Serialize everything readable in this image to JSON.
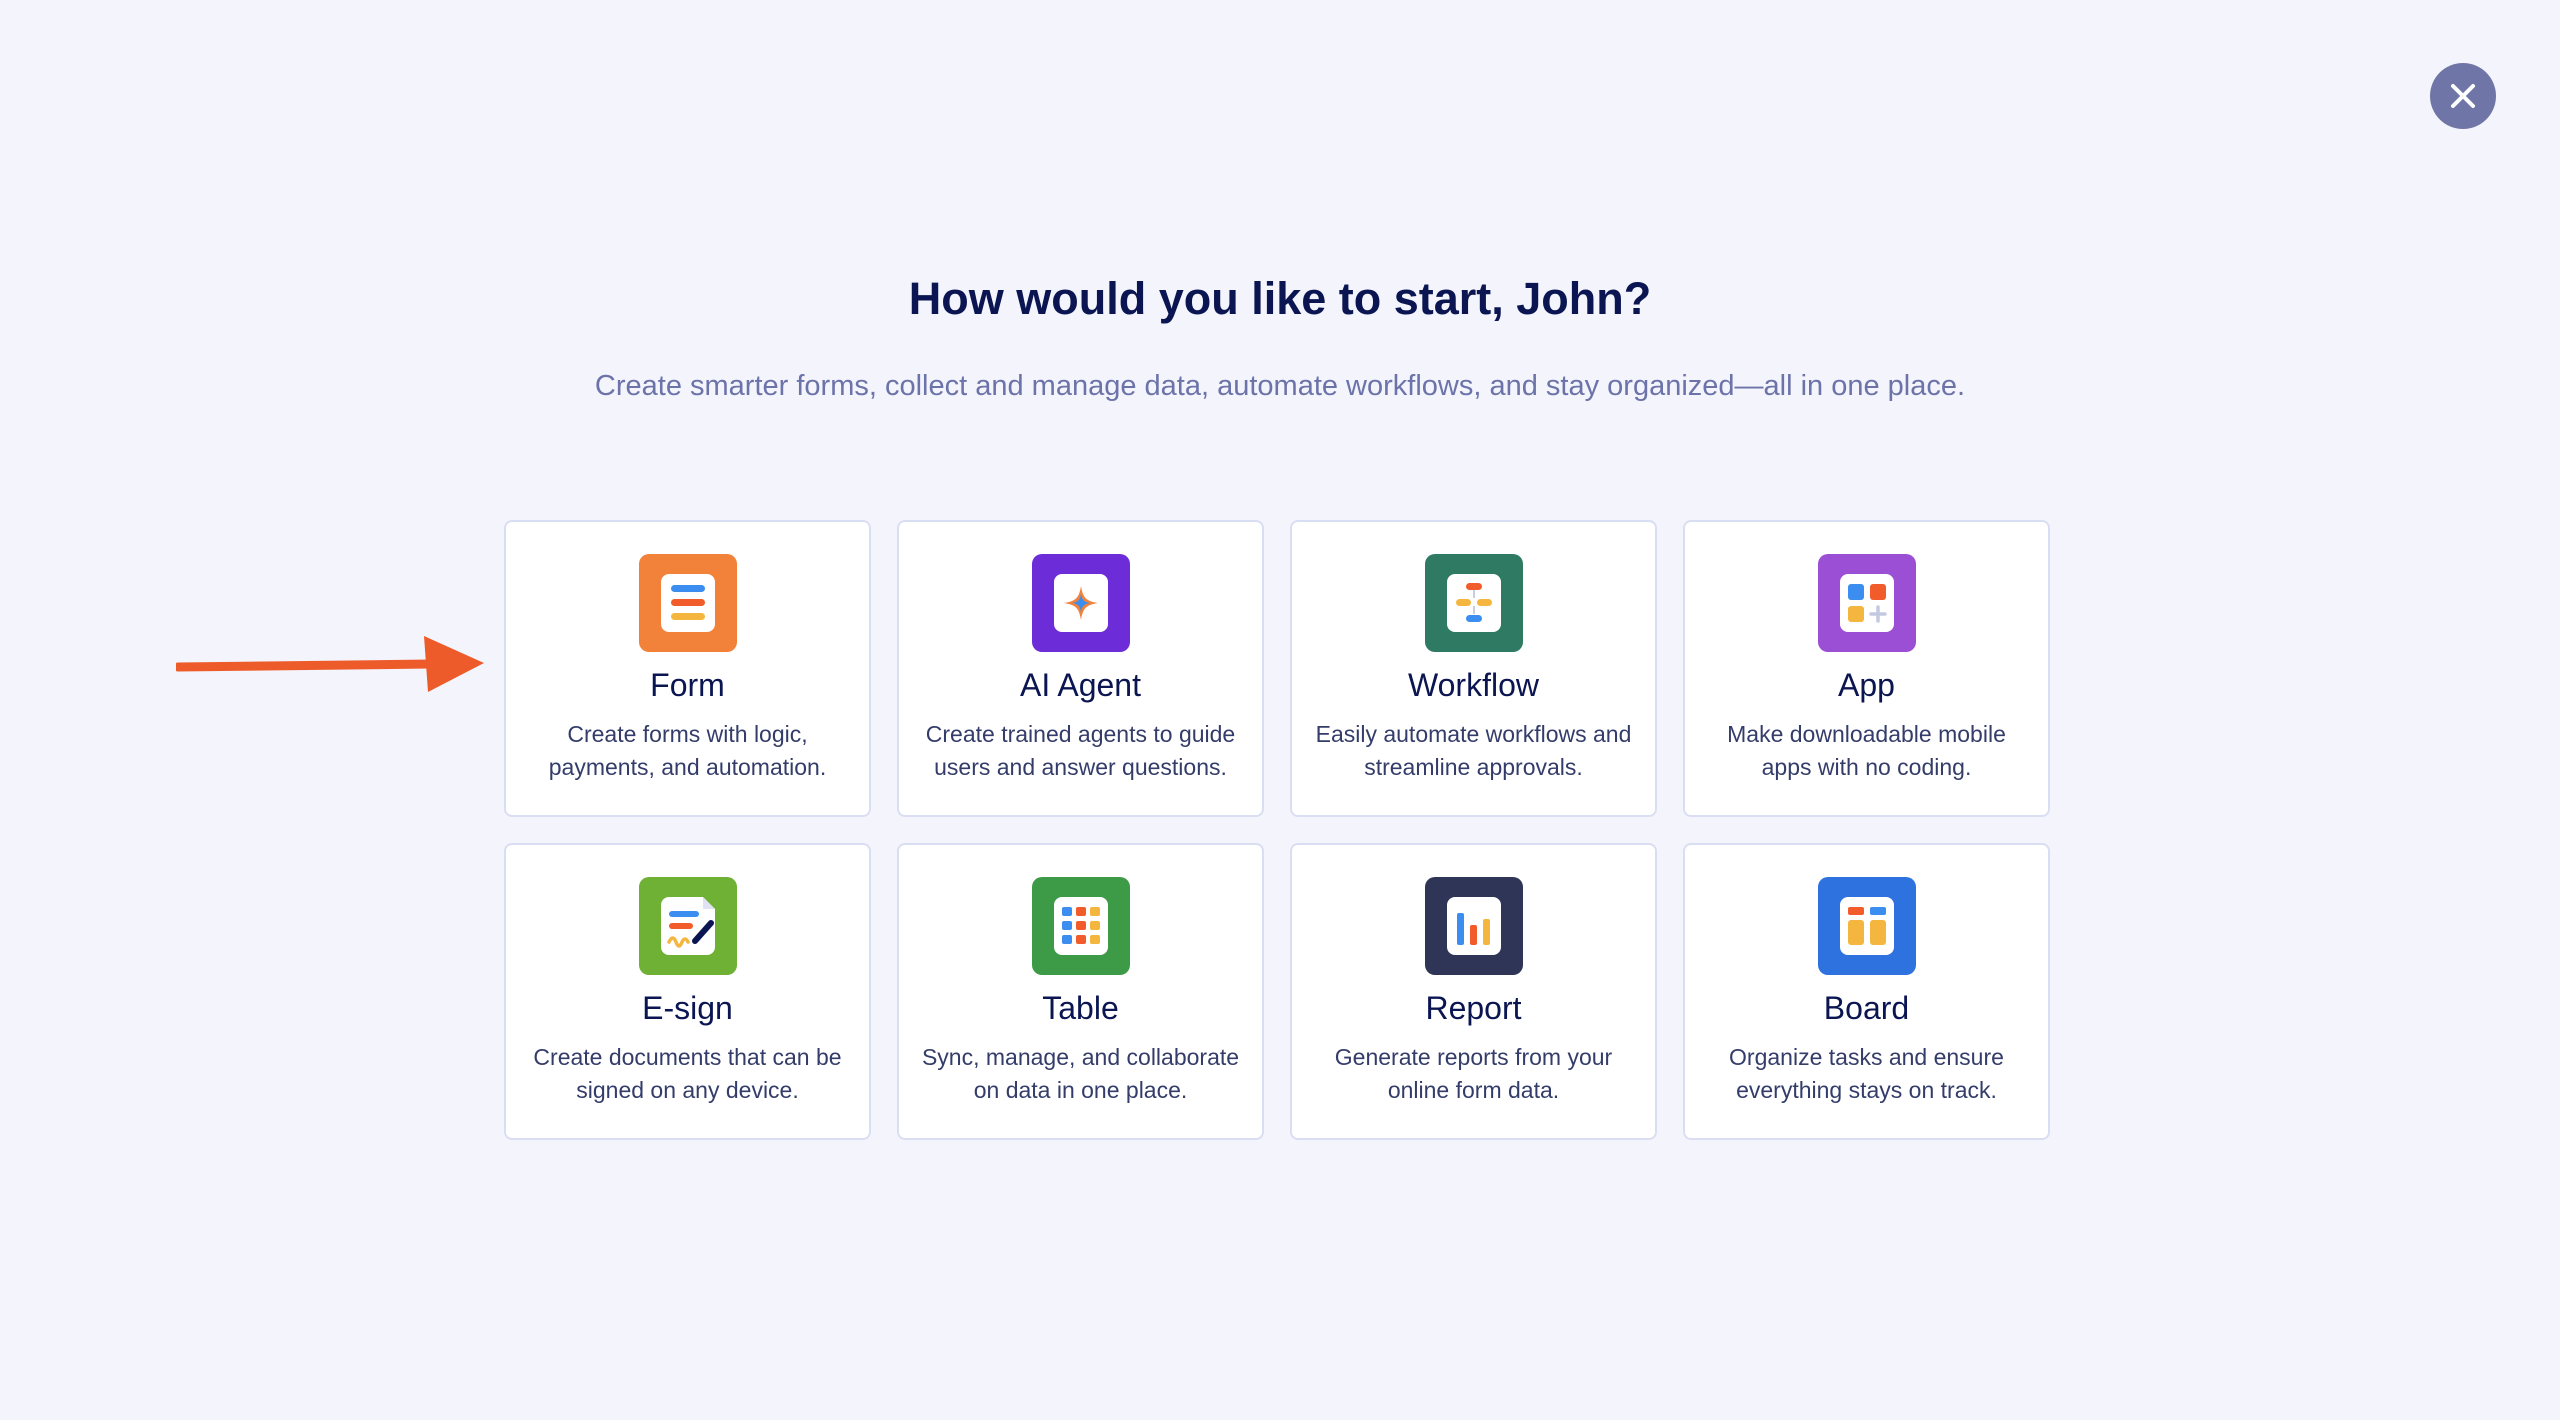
{
  "header": {
    "title": "How would you like to start, John?",
    "subtitle": "Create smarter forms, collect and manage data, automate workflows, and stay organized—all in one place."
  },
  "close": {
    "icon": "close-icon"
  },
  "options": [
    {
      "title": "Form",
      "description": "Create forms with logic, payments, and automation.",
      "icon": "form-icon",
      "color": "#f2823a"
    },
    {
      "title": "AI Agent",
      "description": "Create trained agents to guide users and answer questions.",
      "icon": "ai-sparkle-icon",
      "color": "#6c2dd9"
    },
    {
      "title": "Workflow",
      "description": "Easily automate workflows and streamline approvals.",
      "icon": "workflow-icon",
      "color": "#2f7a63"
    },
    {
      "title": "App",
      "description": "Make downloadable mobile apps with no coding.",
      "icon": "app-grid-icon",
      "color": "#9b4fd4"
    },
    {
      "title": "E-sign",
      "description": "Create documents that can be signed on any device.",
      "icon": "esign-icon",
      "color": "#6fb135"
    },
    {
      "title": "Table",
      "description": "Sync, manage, and collaborate on data in one place.",
      "icon": "table-icon",
      "color": "#3d9b47"
    },
    {
      "title": "Report",
      "description": "Generate reports from your online form data.",
      "icon": "report-icon",
      "color": "#2e3557"
    },
    {
      "title": "Board",
      "description": "Organize tasks and ensure everything stays on track.",
      "icon": "board-icon",
      "color": "#2e72e0"
    }
  ],
  "annotation": {
    "arrow_color": "#ee5b2a",
    "icon": "pointer-arrow-icon"
  }
}
